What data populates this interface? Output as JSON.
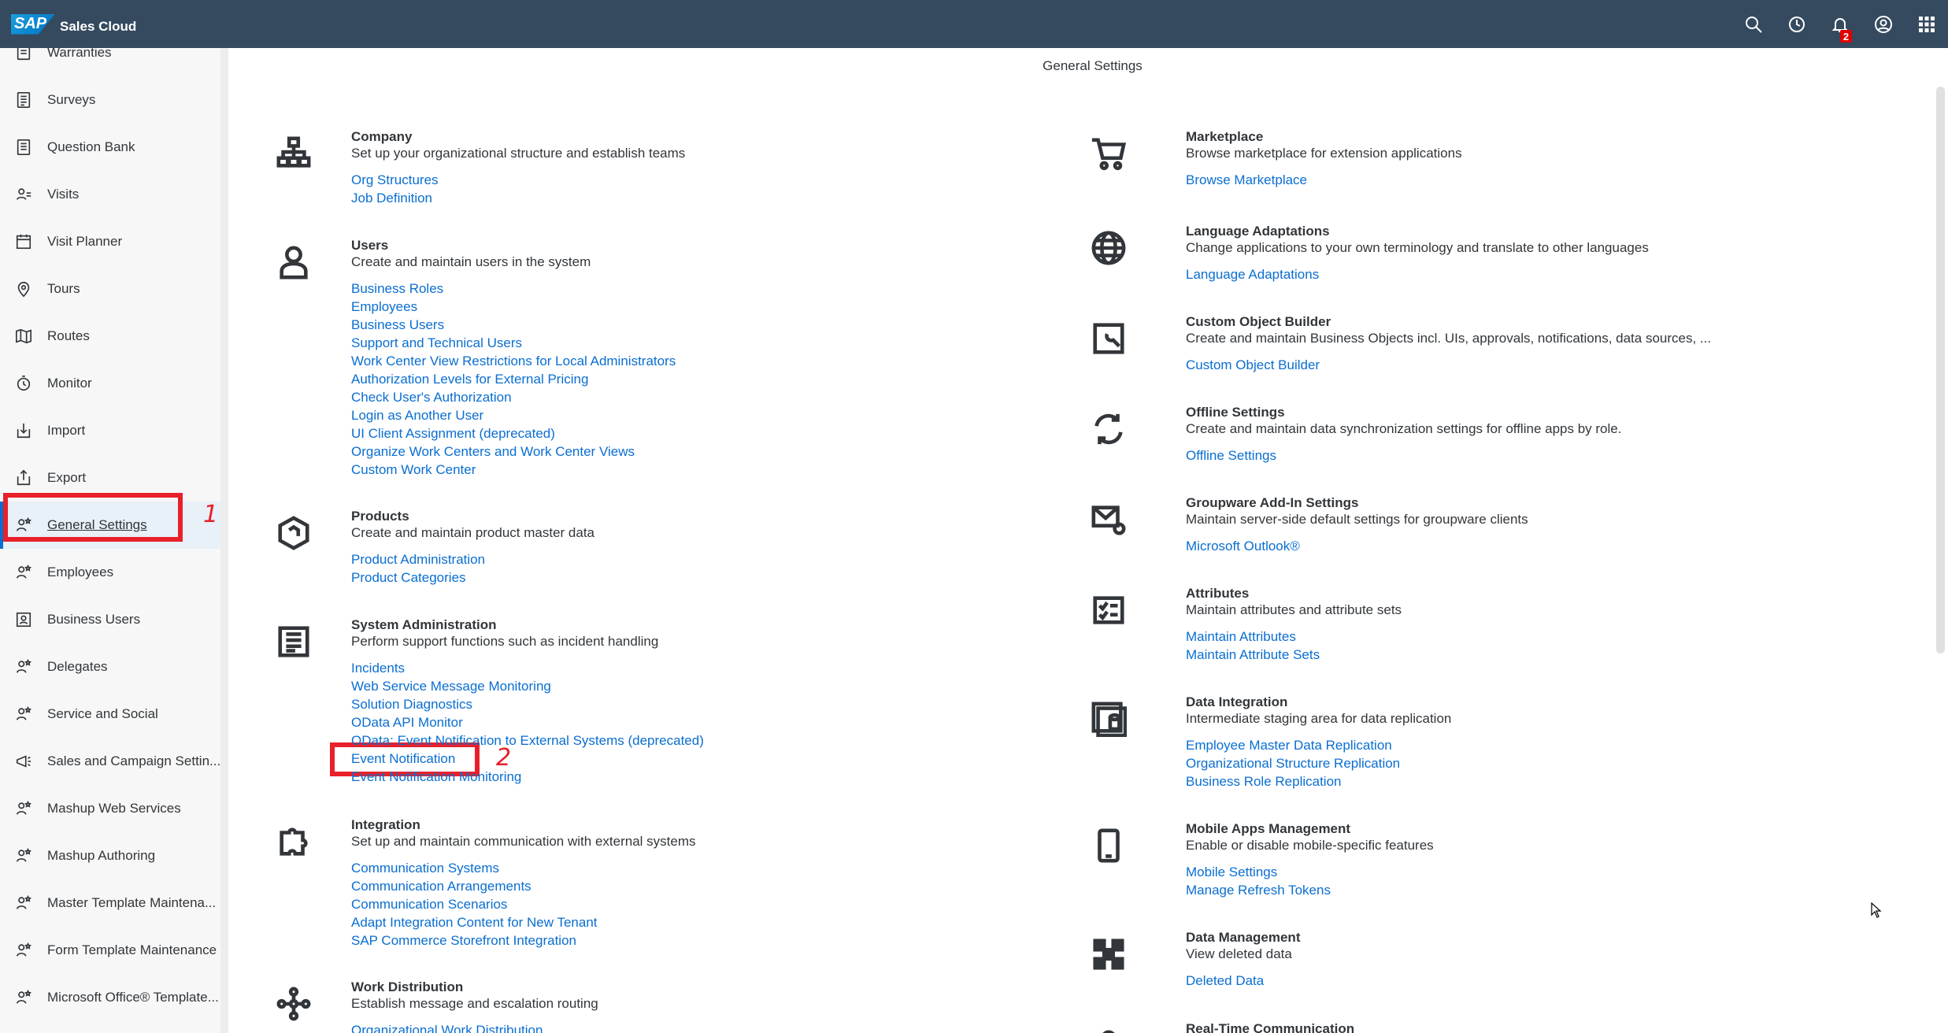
{
  "shell": {
    "logo_text": "SAP",
    "app_title": "Sales Cloud",
    "notification_count": "2",
    "actions": [
      "search-icon",
      "history-icon",
      "bell-icon",
      "user-icon",
      "grid-icon"
    ]
  },
  "sidebar": {
    "items": [
      {
        "label": "Warranties",
        "icon": "warranty-icon"
      },
      {
        "label": "Surveys",
        "icon": "survey-icon"
      },
      {
        "label": "Question Bank",
        "icon": "question-bank-icon"
      },
      {
        "label": "Visits",
        "icon": "visits-icon"
      },
      {
        "label": "Visit Planner",
        "icon": "visit-planner-icon"
      },
      {
        "label": "Tours",
        "icon": "location-icon"
      },
      {
        "label": "Routes",
        "icon": "map-icon"
      },
      {
        "label": "Monitor",
        "icon": "monitor-icon"
      },
      {
        "label": "Import",
        "icon": "import-icon"
      },
      {
        "label": "Export",
        "icon": "export-icon"
      },
      {
        "label": "General Settings",
        "icon": "settings-people-icon",
        "active": true
      },
      {
        "label": "Employees",
        "icon": "people-icon"
      },
      {
        "label": "Business Users",
        "icon": "business-user-icon"
      },
      {
        "label": "Delegates",
        "icon": "people-icon"
      },
      {
        "label": "Service and Social",
        "icon": "people-icon"
      },
      {
        "label": "Sales and Campaign Settin...",
        "icon": "campaign-icon"
      },
      {
        "label": "Mashup Web Services",
        "icon": "people-icon"
      },
      {
        "label": "Mashup Authoring",
        "icon": "people-icon"
      },
      {
        "label": "Master Template Maintena...",
        "icon": "people-icon"
      },
      {
        "label": "Form Template Maintenance",
        "icon": "people-icon"
      },
      {
        "label": "Microsoft Office® Template...",
        "icon": "people-icon"
      }
    ],
    "collapse_glyph": "«"
  },
  "annotations": {
    "one": "1",
    "two": "2"
  },
  "main": {
    "title": "General Settings",
    "left_sections": [
      {
        "title": "Company",
        "desc": "Set up your organizational structure and establish teams",
        "links": [
          "Org Structures",
          "Job Definition"
        ],
        "icon": "org-structure-icon"
      },
      {
        "title": "Users",
        "desc": "Create and maintain users in the system",
        "links": [
          "Business Roles",
          "Employees",
          "Business Users",
          "Support and Technical Users",
          "Work Center View Restrictions for Local Administrators",
          "Authorization Levels for External Pricing",
          "Check User's Authorization",
          "Login as Another User",
          "UI Client Assignment (deprecated)",
          "Organize Work Centers and Work Center Views",
          "Custom Work Center"
        ],
        "icon": "user-icon"
      },
      {
        "title": "Products",
        "desc": "Create and maintain product master data",
        "links": [
          "Product Administration",
          "Product Categories"
        ],
        "icon": "product-icon"
      },
      {
        "title": "System Administration",
        "desc": "Perform support functions such as incident handling",
        "links": [
          "Incidents",
          "Web Service Message Monitoring",
          "Solution Diagnostics",
          "OData API Monitor",
          "OData: Event Notification to External Systems (deprecated)",
          "Event Notification",
          "Event Notification Monitoring"
        ],
        "icon": "document-icon"
      },
      {
        "title": "Integration",
        "desc": "Set up and maintain communication with external systems",
        "links": [
          "Communication Systems",
          "Communication Arrangements",
          "Communication Scenarios",
          "Adapt Integration Content for New Tenant",
          "SAP Commerce Storefront Integration"
        ],
        "icon": "puzzle-icon"
      },
      {
        "title": "Work Distribution",
        "desc": "Establish message and escalation routing",
        "links": [
          "Organizational Work Distribution"
        ],
        "icon": "network-icon"
      }
    ],
    "right_sections": [
      {
        "title": "Marketplace",
        "desc": "Browse marketplace for extension applications",
        "links": [
          "Browse Marketplace"
        ],
        "icon": "cart-icon"
      },
      {
        "title": "Language Adaptations",
        "desc": "Change applications to your own terminology and translate to other languages",
        "links": [
          "Language Adaptations"
        ],
        "icon": "globe-icon"
      },
      {
        "title": "Custom Object Builder",
        "desc": "Create and maintain Business Objects incl. UIs, approvals, notifications, data sources, ...",
        "links": [
          "Custom Object Builder"
        ],
        "icon": "wrench-icon"
      },
      {
        "title": "Offline Settings",
        "desc": "Create and maintain data synchronization settings for offline apps by role.",
        "links": [
          "Offline Settings"
        ],
        "icon": "sync-icon"
      },
      {
        "title": "Groupware Add-In Settings",
        "desc": "Maintain server-side default settings for groupware clients",
        "links": [
          "Microsoft Outlook®"
        ],
        "icon": "mail-settings-icon"
      },
      {
        "title": "Attributes",
        "desc": "Maintain attributes and attribute sets",
        "links": [
          "Maintain Attributes",
          "Maintain Attribute Sets"
        ],
        "icon": "checklist-icon"
      },
      {
        "title": "Data Integration",
        "desc": "Intermediate staging area for data replication",
        "links": [
          "Employee Master Data Replication",
          "Organizational Structure Replication",
          "Business Role Replication"
        ],
        "icon": "data-integration-icon"
      },
      {
        "title": "Mobile Apps Management",
        "desc": "Enable or disable mobile-specific features",
        "links": [
          "Mobile Settings",
          "Manage Refresh Tokens"
        ],
        "icon": "phone-icon"
      },
      {
        "title": "Data Management",
        "desc": "View deleted data",
        "links": [
          "Deleted Data"
        ],
        "icon": "checker-icon"
      },
      {
        "title": "Real-Time Communication",
        "desc": "",
        "links": [],
        "icon": "person-icon"
      }
    ]
  }
}
